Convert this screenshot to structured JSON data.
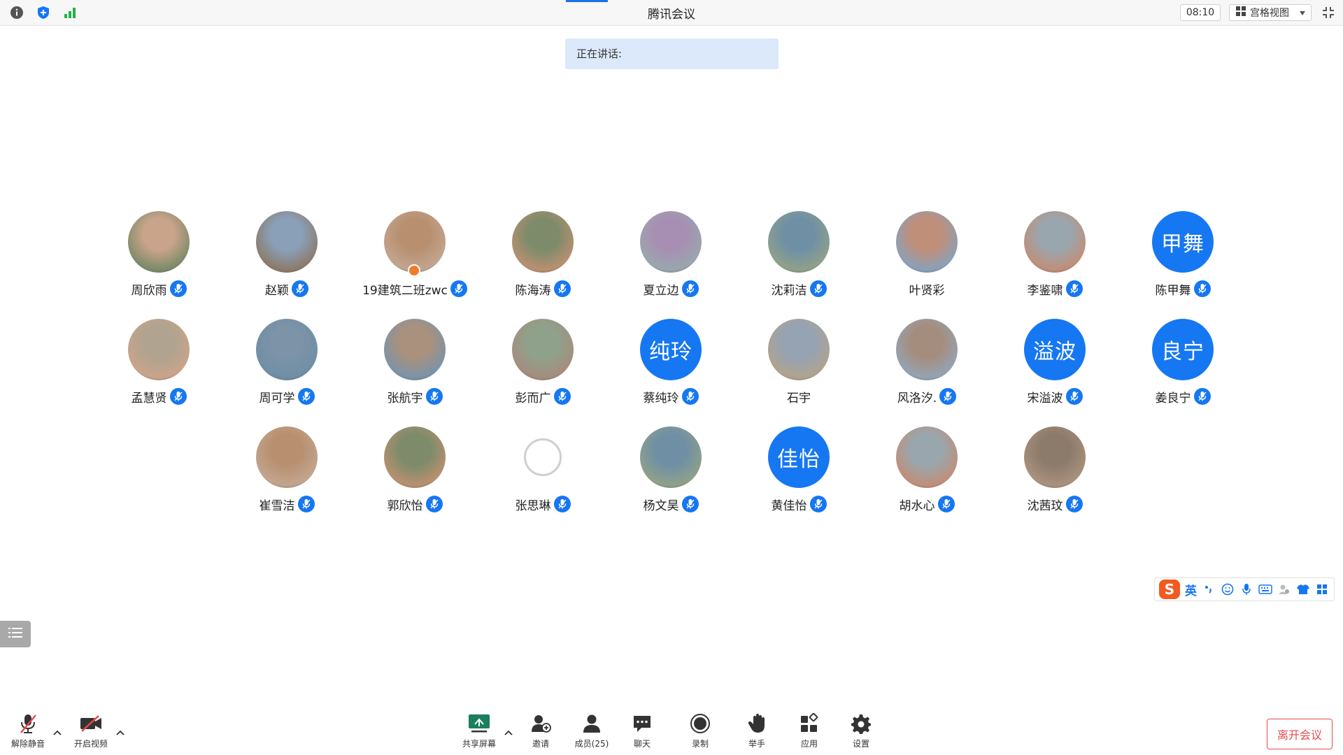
{
  "topbar": {
    "title": "腾讯会议",
    "time": "08:10",
    "view_label": "宫格视图"
  },
  "speaking": {
    "label": "正在讲话:"
  },
  "participants": [
    {
      "name": "周欣雨",
      "avatar": "photo",
      "mic": true
    },
    {
      "name": "赵颖",
      "avatar": "photo",
      "mic": true
    },
    {
      "name": "19建筑二班zwc",
      "avatar": "photo",
      "mic": true
    },
    {
      "name": "陈海涛",
      "avatar": "photo",
      "mic": true
    },
    {
      "name": "夏立边",
      "avatar": "photo",
      "mic": true
    },
    {
      "name": "沈莉洁",
      "avatar": "photo",
      "mic": true
    },
    {
      "name": "叶贤彩",
      "avatar": "photo",
      "mic": false
    },
    {
      "name": "李鉴啸",
      "avatar": "photo",
      "mic": true
    },
    {
      "name": "陈甲舞",
      "avatar": "甲舞",
      "mic": true
    },
    {
      "name": "孟慧贤",
      "avatar": "photo",
      "mic": true
    },
    {
      "name": "周可学",
      "avatar": "photo",
      "mic": true
    },
    {
      "name": "张航宇",
      "avatar": "photo",
      "mic": true
    },
    {
      "name": "彭而广",
      "avatar": "photo",
      "mic": true
    },
    {
      "name": "蔡纯玲",
      "avatar": "纯玲",
      "mic": true
    },
    {
      "name": "石宇",
      "avatar": "photo",
      "mic": false
    },
    {
      "name": "风洛汐.",
      "avatar": "photo",
      "mic": true
    },
    {
      "name": "宋溢波",
      "avatar": "溢波",
      "mic": true
    },
    {
      "name": "姜良宁",
      "avatar": "良宁",
      "mic": true
    },
    {
      "name": "崔雪洁",
      "avatar": "photo",
      "mic": true
    },
    {
      "name": "郭欣怡",
      "avatar": "photo",
      "mic": true
    },
    {
      "name": "张思琳",
      "avatar": "empty",
      "mic": true
    },
    {
      "name": "杨文昊",
      "avatar": "photo",
      "mic": true
    },
    {
      "name": "黄佳怡",
      "avatar": "佳怡",
      "mic": true
    },
    {
      "name": "胡水心",
      "avatar": "photo",
      "mic": true
    },
    {
      "name": "沈茜玟",
      "avatar": "photo",
      "mic": true
    }
  ],
  "ime": {
    "lang": "英"
  },
  "toolbar": {
    "unmute": "解除静音",
    "video": "开启视频",
    "share": "共享屏幕",
    "invite": "邀请",
    "members": "成员(25)",
    "chat": "聊天",
    "record": "录制",
    "raise_hand": "举手",
    "apps": "应用",
    "settings": "设置",
    "leave": "离开会议"
  },
  "colors": {
    "accent": "#1677f2",
    "leave": "#e84a4a",
    "speaking_bg": "#dce9fb"
  }
}
